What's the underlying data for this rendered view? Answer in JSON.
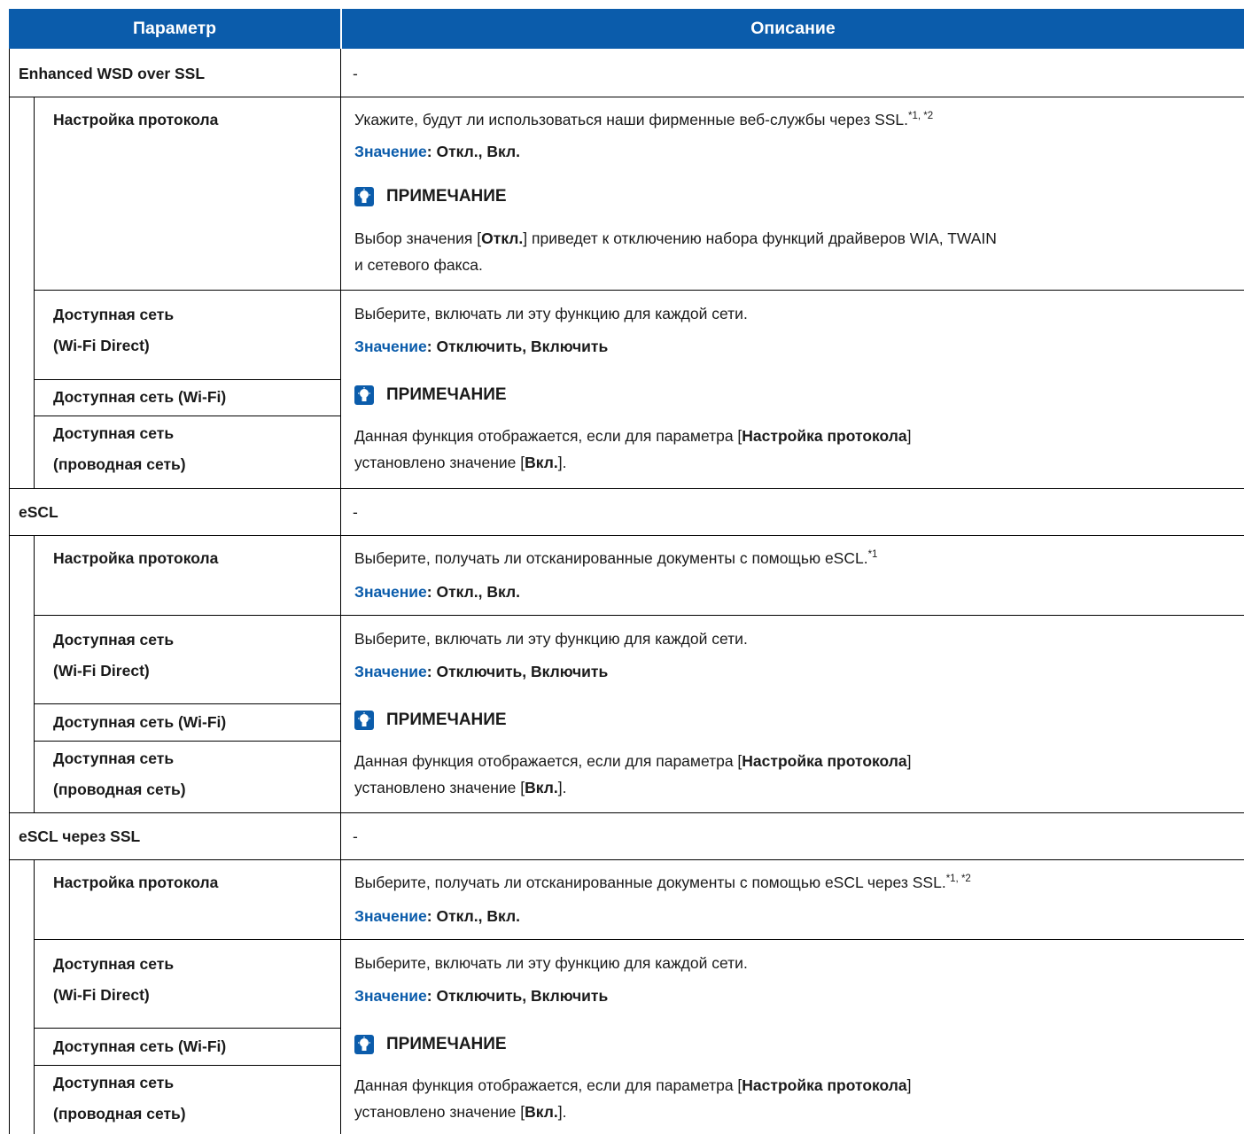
{
  "header": {
    "param": "Параметр",
    "desc": "Описание"
  },
  "common": {
    "dash": "-",
    "value_label": "Значение",
    "note_title": "ПРИМЕЧАНИЕ",
    "network_desc": "Выберите, включать ли эту функцию для каждой сети.",
    "network_value": ": Отключить, Включить",
    "onoff_value": ": Откл., Вкл.",
    "net_wifi_direct_1": "Доступная сеть",
    "net_wifi_direct_2": "(Wi-Fi Direct)",
    "net_wifi": "Доступная сеть (Wi-Fi)",
    "net_wired_1": "Доступная сеть",
    "net_wired_2": "(проводная сеть)",
    "protocol_setting": "Настройка протокола",
    "note2_a": "Данная функция отображается, если для параметра [",
    "note2_b": "Настройка протокола",
    "note2_c": "]",
    "note2_d": "установлено значение [",
    "note2_e": "Вкл.",
    "note2_f": "]."
  },
  "sections": {
    "s1": {
      "title": "Enhanced WSD over SSL",
      "protocol_desc": "Укажите, будут ли использоваться наши фирменные веб-службы через SSL.",
      "protocol_sup": "*1,  *2",
      "note1_a": "Выбор значения [",
      "note1_b": "Откл.",
      "note1_c": "] приведет к отключению набора функций драйверов WIA, TWAIN",
      "note1_d": "и сетевого факса."
    },
    "s2": {
      "title": "eSCL",
      "protocol_desc": "Выберите, получать ли отсканированные документы с помощью eSCL.",
      "protocol_sup": "*1"
    },
    "s3": {
      "title": "eSCL через SSL",
      "protocol_desc": "Выберите, получать ли отсканированные документы с помощью eSCL через SSL.",
      "protocol_sup": "*1,  *2"
    }
  },
  "colors": {
    "header_bg": "#0b5cab",
    "accent": "#0b5cab"
  }
}
